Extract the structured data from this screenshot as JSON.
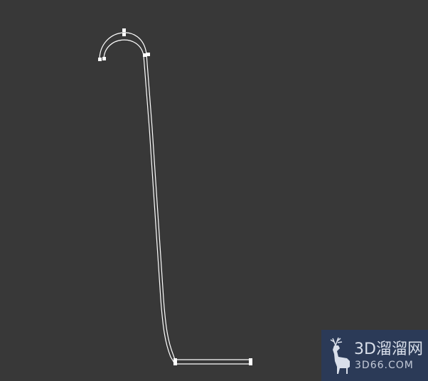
{
  "viewport": {
    "background": "#383838",
    "spline_color": "#ffffff",
    "vertex_color": "#ffffff"
  },
  "watermark": {
    "title": "3D溜溜网",
    "url": "3D66.COM",
    "logo_icon": "deer-icon",
    "background": "#2b3a57"
  }
}
